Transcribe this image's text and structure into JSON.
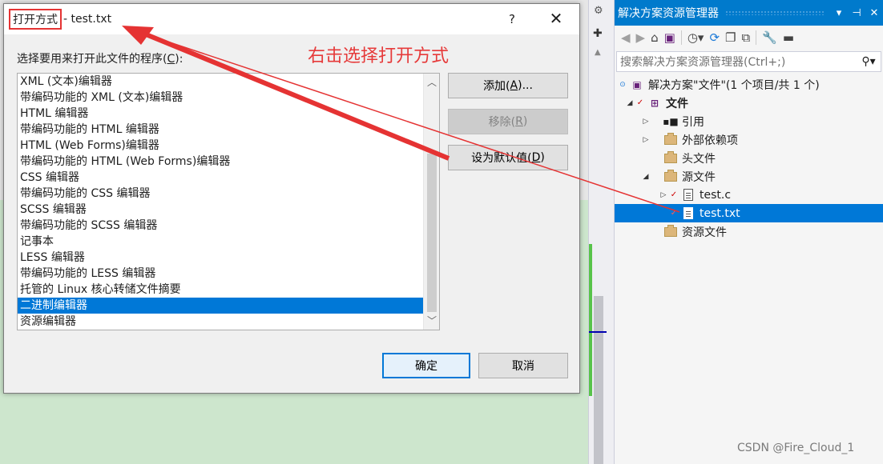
{
  "dialog": {
    "title_highlight": "打开方式",
    "title_rest": " - test.txt",
    "help": "?",
    "close": "✕",
    "prompt_prefix": "选择要用来打开此文件的程序(",
    "prompt_key": "C",
    "prompt_suffix": "):",
    "programs": [
      "XML (文本)编辑器",
      "带编码功能的 XML (文本)编辑器",
      "HTML 编辑器",
      "带编码功能的 HTML 编辑器",
      "HTML (Web Forms)编辑器",
      "带编码功能的 HTML (Web Forms)编辑器",
      "CSS 编辑器",
      "带编码功能的 CSS 编辑器",
      "SCSS 编辑器",
      "带编码功能的 SCSS 编辑器",
      "记事本",
      "LESS 编辑器",
      "带编码功能的 LESS 编辑器",
      "托管的 Linux 核心转储文件摘要",
      "二进制编辑器",
      "资源编辑器"
    ],
    "selected_program": "二进制编辑器",
    "add_label": "添加(",
    "add_key": "A",
    "add_suffix": ")...",
    "remove_label": "移除(",
    "remove_key": "R",
    "remove_suffix": ")",
    "default_label": "设为默认值(",
    "default_key": "D",
    "default_suffix": ")",
    "ok_label": "确定",
    "cancel_label": "取消"
  },
  "annotation": {
    "text": "右击选择打开方式",
    "color": "#e63a3a"
  },
  "solution_explorer": {
    "title": "解决方案资源管理器",
    "title_controls": [
      "▾",
      "⊣",
      "✕"
    ],
    "search_placeholder": "搜索解决方案资源管理器(Ctrl+;)",
    "accent": "#007acc",
    "tree": [
      {
        "label": "解决方案\"文件\"(1 个项目/共 1 个)",
        "icon": "solution-icon"
      },
      {
        "label": "文件",
        "icon": "project-icon"
      },
      {
        "label": "引用",
        "icon": "references-icon"
      },
      {
        "label": "外部依赖项",
        "icon": "external-deps-icon"
      },
      {
        "label": "头文件",
        "icon": "folder-icon"
      },
      {
        "label": "源文件",
        "icon": "folder-icon"
      },
      {
        "label": "test.c",
        "icon": "c-file-icon"
      },
      {
        "label": "test.txt",
        "icon": "text-file-icon"
      },
      {
        "label": "资源文件",
        "icon": "folder-icon"
      }
    ]
  },
  "watermark": "CSDN @Fire_Cloud_1"
}
